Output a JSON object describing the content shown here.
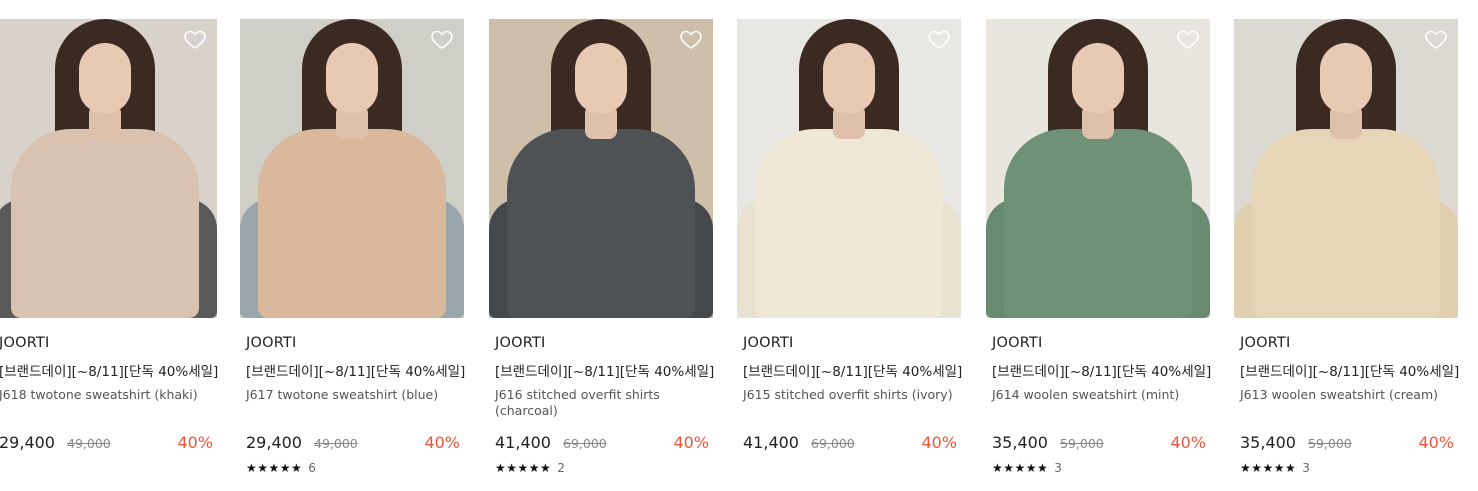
{
  "products": [
    {
      "brand": "JOORTI",
      "promo": "[브랜드데이][~8/11][단독 40%세일]",
      "name": "J618 twotone sweatshirt (khaki)",
      "price": "29,400",
      "original_price": "49,000",
      "discount": "40%",
      "stars": "",
      "review_count": "",
      "wishlisted": false,
      "colors": {
        "bg": "#d8d2cb",
        "garment": "#d9c3b0",
        "sleeve": "#5a5a5a"
      }
    },
    {
      "brand": "JOORTI",
      "promo": "[브랜드데이][~8/11][단독 40%세일]",
      "name": "J617 twotone sweatshirt (blue)",
      "price": "29,400",
      "original_price": "49,000",
      "discount": "40%",
      "stars": "★★★★★",
      "review_count": "6",
      "wishlisted": false,
      "colors": {
        "bg": "#cfcfc8",
        "garment": "#d9b89c",
        "sleeve": "#9aa6ac"
      }
    },
    {
      "brand": "JOORTI",
      "promo": "[브랜드데이][~8/11][단독 40%세일]",
      "name": "J616 stitched overfit shirts (charcoal)",
      "price": "41,400",
      "original_price": "69,000",
      "discount": "40%",
      "stars": "★★★★★",
      "review_count": "2",
      "wishlisted": false,
      "colors": {
        "bg": "#cdbfa9",
        "garment": "#4f5255",
        "sleeve": "#45484b"
      }
    },
    {
      "brand": "JOORTI",
      "promo": "[브랜드데이][~8/11][단독 40%세일]",
      "name": "J615 stitched overfit shirts (ivory)",
      "price": "41,400",
      "original_price": "69,000",
      "discount": "40%",
      "stars": "",
      "review_count": "",
      "wishlisted": false,
      "colors": {
        "bg": "#e8e7e3",
        "garment": "#efe8d6",
        "sleeve": "#e9e2cf"
      }
    },
    {
      "brand": "JOORTI",
      "promo": "[브랜드데이][~8/11][단독 40%세일]",
      "name": "J614 woolen sweatshirt (mint)",
      "price": "35,400",
      "original_price": "59,000",
      "discount": "40%",
      "stars": "★★★★★",
      "review_count": "3",
      "wishlisted": false,
      "colors": {
        "bg": "#e9e5df",
        "garment": "#6f9178",
        "sleeve": "#678a70"
      }
    },
    {
      "brand": "JOORTI",
      "promo": "[브랜드데이][~8/11][단독 40%세일]",
      "name": "J613 woolen sweatshirt (cream)",
      "price": "35,400",
      "original_price": "59,000",
      "discount": "40%",
      "stars": "★★★★★",
      "review_count": "3",
      "wishlisted": false,
      "colors": {
        "bg": "#dcd9d3",
        "garment": "#e6d5b7",
        "sleeve": "#e1cfb0"
      }
    }
  ],
  "icons": {
    "wishlist": "heart-outline-icon",
    "rating": "star-icon"
  },
  "theme": {
    "discount_color": "#f0553a"
  }
}
